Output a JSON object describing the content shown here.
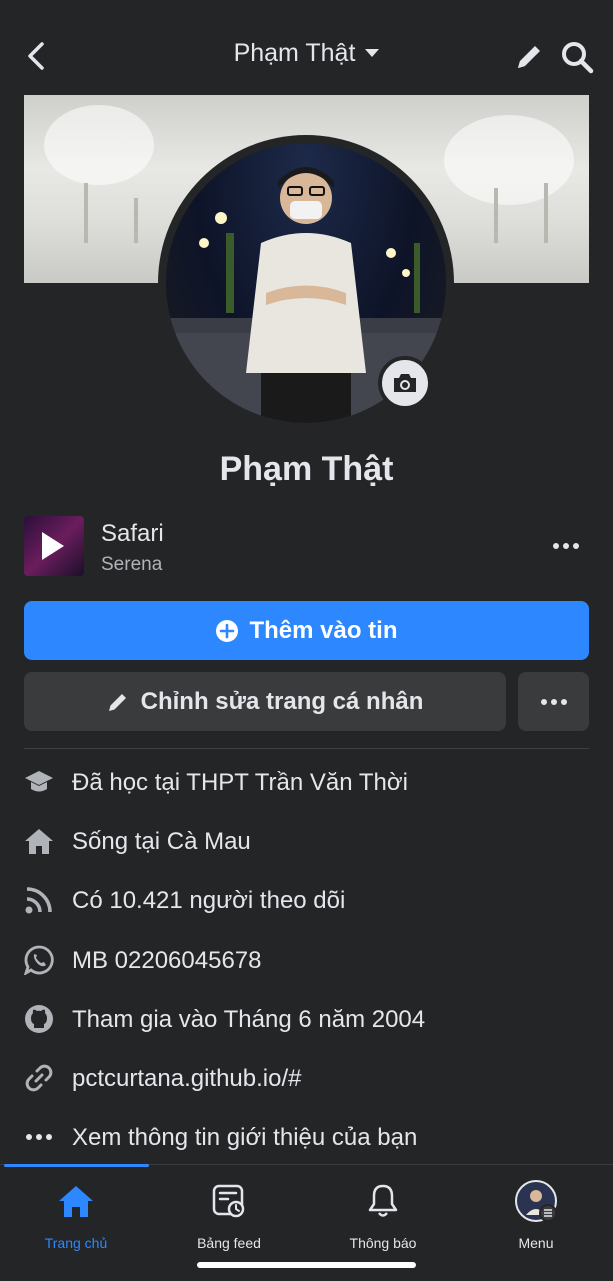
{
  "header": {
    "title": "Phạm Thật"
  },
  "profile": {
    "name": "Phạm Thật"
  },
  "music": {
    "song": "Safari",
    "artist": "Serena"
  },
  "actions": {
    "add_story": "Thêm vào tin",
    "edit_profile": "Chỉnh sửa trang cá nhân"
  },
  "info": [
    {
      "icon": "graduation-cap-icon",
      "text": "Đã học tại THPT Trần Văn Thời"
    },
    {
      "icon": "home-icon",
      "text": "Sống tại Cà Mau"
    },
    {
      "icon": "rss-icon",
      "text": "Có 10.421 người theo dõi"
    },
    {
      "icon": "whatsapp-icon",
      "text": "MB 02206045678"
    },
    {
      "icon": "github-icon",
      "text": "Tham gia vào Tháng 6 năm 2004"
    },
    {
      "icon": "link-icon",
      "text": "pctcurtana.github.io/#"
    },
    {
      "icon": "more-dots-icon",
      "text": "Xem thông tin giới thiệu của bạn"
    }
  ],
  "tabs": [
    {
      "label": "Trang chủ",
      "active": true
    },
    {
      "label": "Bảng feed",
      "active": false
    },
    {
      "label": "Thông báo",
      "active": false
    },
    {
      "label": "Menu",
      "active": false
    }
  ],
  "colors": {
    "background": "#242526",
    "accent": "#2d88ff",
    "secondary_button": "#3a3b3c",
    "text": "#e4e6eb",
    "muted_text": "#b0b3b8"
  }
}
